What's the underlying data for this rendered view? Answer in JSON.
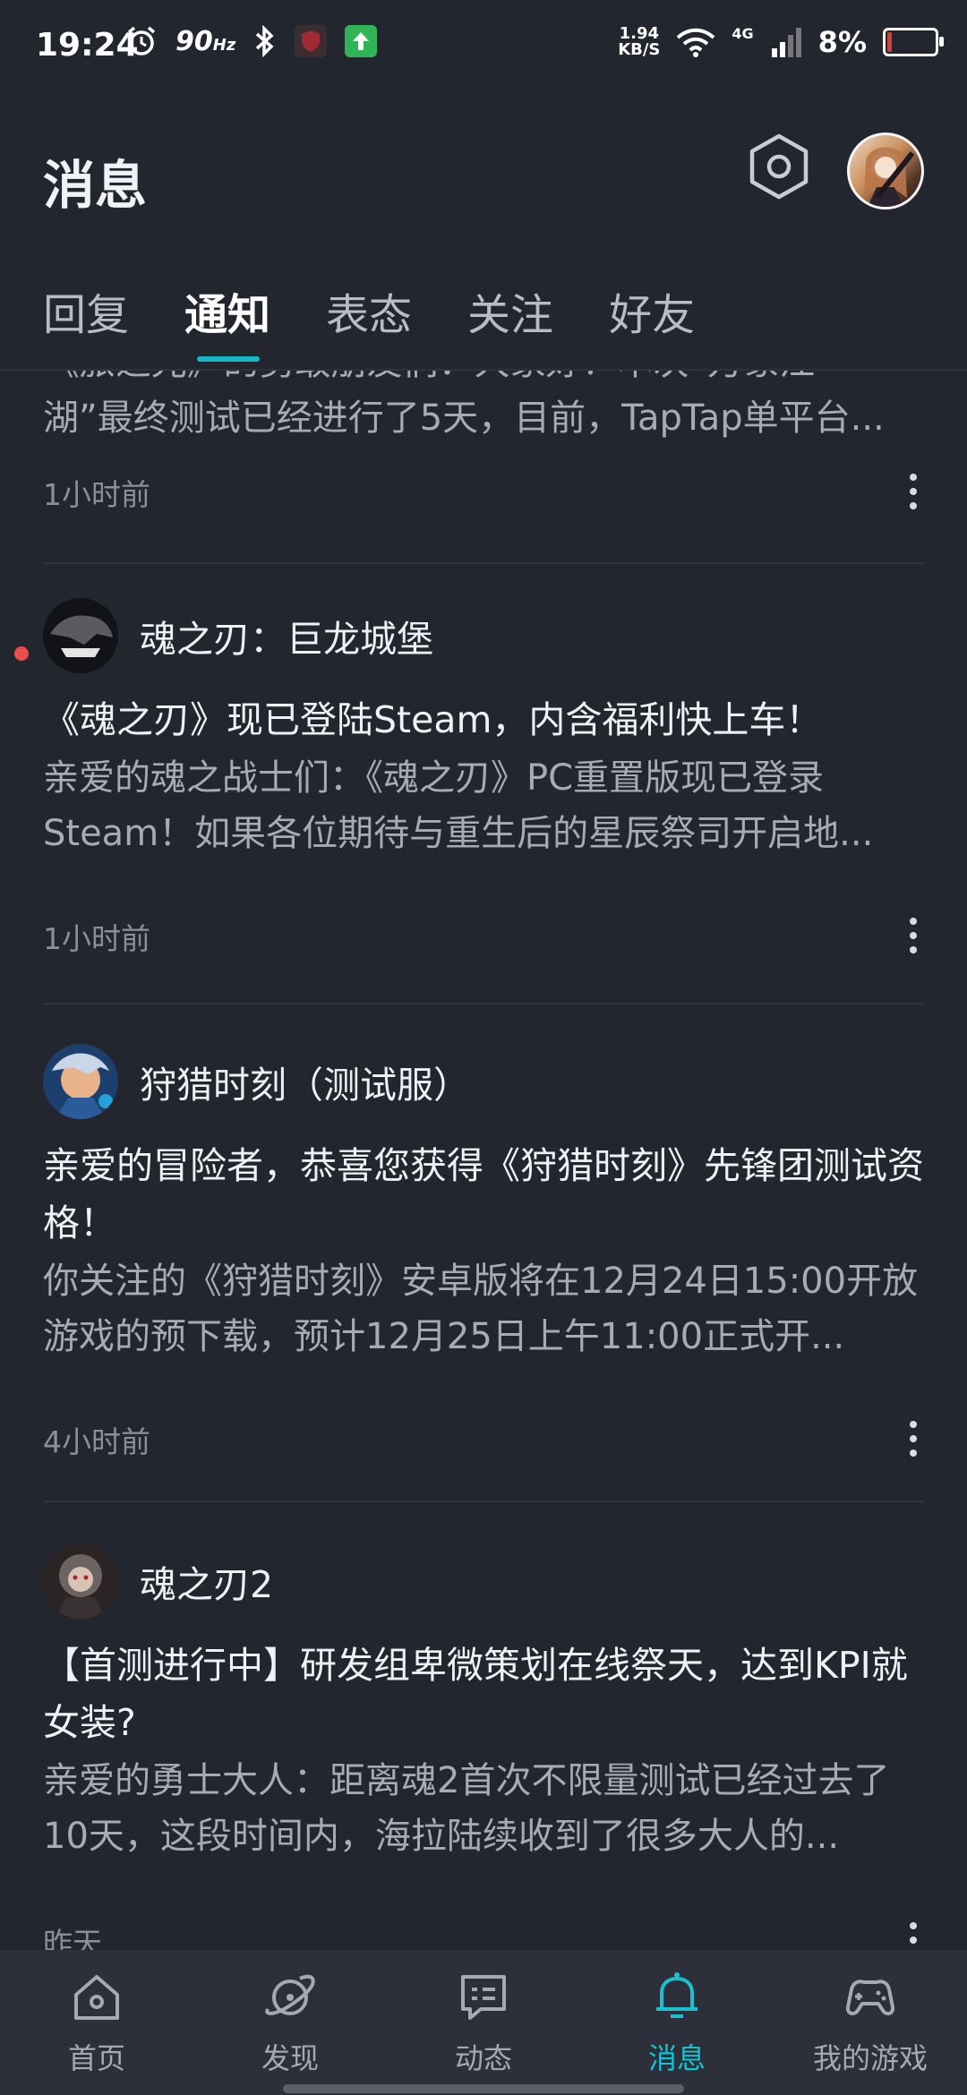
{
  "status_bar": {
    "time": "19:24",
    "refresh_rate": "90",
    "refresh_unit": "Hz",
    "net_speed_value": "1.94",
    "net_speed_unit": "KB/S",
    "network_type": "4G",
    "battery_percent": "8%",
    "icons": [
      "alarm-icon",
      "bluetooth-icon",
      "shield-app-icon",
      "upload-app-icon",
      "wifi-icon",
      "signal-icon",
      "battery-icon"
    ]
  },
  "header": {
    "title": "消息",
    "settings_icon": "hexagon-settings-icon",
    "avatar": "user-avatar"
  },
  "tabs": [
    {
      "label": "回复",
      "active": false
    },
    {
      "label": "通知",
      "active": true
    },
    {
      "label": "表态",
      "active": false
    },
    {
      "label": "关注",
      "active": false
    },
    {
      "label": "好友",
      "active": false
    }
  ],
  "accent_color": "#16b8c8",
  "feed": {
    "partial_item": {
      "top_line": "“《旅之光》”的勇敢朋友们：大家好！本次“万象江",
      "body_line": "湖”最终测试已经进行了5天，目前，TapTap单平台...",
      "time": "1小时前"
    },
    "items": [
      {
        "game": "魂之刃：巨龙城堡",
        "unread": true,
        "title": "《魂之刃》现已登陆Steam，内含福利快上车！",
        "body": "亲爱的魂之战士们：《魂之刃》PC重置版现已登录Steam！如果各位期待与重生后的星辰祭司开启地...",
        "time": "1小时前"
      },
      {
        "game": "狩猎时刻（测试服）",
        "unread": false,
        "title": "亲爱的冒险者，恭喜您获得《狩猎时刻》先锋团测试资格！",
        "body": "你关注的《狩猎时刻》安卓版将在12月24日15:00开放游戏的预下载，预计12月25日上午11:00正式开...",
        "time": "4小时前"
      },
      {
        "game": "魂之刃2",
        "unread": false,
        "title": "【首测进行中】研发组卑微策划在线祭天，达到KPI就女装?",
        "body": "亲爱的勇士大人：距离魂2首次不限量测试已经过去了10天，这段时间内，海拉陆续收到了很多大人的...",
        "time": "昨天"
      }
    ]
  },
  "bottom_nav": [
    {
      "label": "首页",
      "icon": "home-icon",
      "active": false
    },
    {
      "label": "发现",
      "icon": "discover-planet-icon",
      "active": false
    },
    {
      "label": "动态",
      "icon": "feed-message-icon",
      "active": false
    },
    {
      "label": "消息",
      "icon": "bell-icon",
      "active": true
    },
    {
      "label": "我的游戏",
      "icon": "gamepad-icon",
      "active": false
    }
  ]
}
